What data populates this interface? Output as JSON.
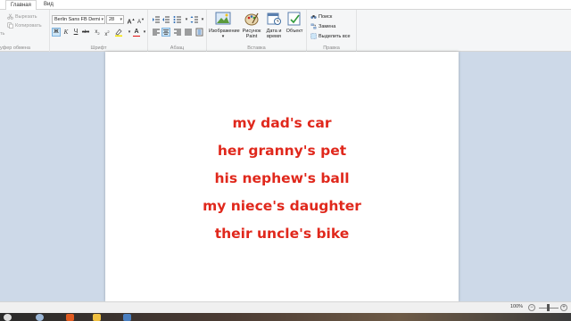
{
  "tabs": [
    "Главная",
    "Вид"
  ],
  "clipboard": {
    "paste_fragment": "ть",
    "cut": "Вырезать",
    "copy": "Копировать",
    "label": "уфер обмена"
  },
  "font": {
    "family": "Berlin Sans FB Demi",
    "size": "28",
    "label": "Шрифт"
  },
  "paragraph": {
    "label": "Абзац"
  },
  "insert": {
    "image": "Изображение",
    "drawing": "Рисунок Paint",
    "datetime": "Дата и время",
    "object": "Объект",
    "label": "Вставка"
  },
  "editing": {
    "find": "Поиск",
    "replace": "Замена",
    "select_all": "Выделить все",
    "label": "Правка"
  },
  "document": {
    "lines": [
      "my dad's car",
      "her granny's pet",
      "his nephew's ball",
      "my niece's daughter",
      "their uncle's bike"
    ],
    "text_color": "#e0281c"
  },
  "status": {
    "zoom": "100%"
  },
  "colors": {
    "ribbon_bg": "#f5f6f7",
    "workspace_bg": "#cdd9e8",
    "selected_btn": "#cde6f7"
  }
}
